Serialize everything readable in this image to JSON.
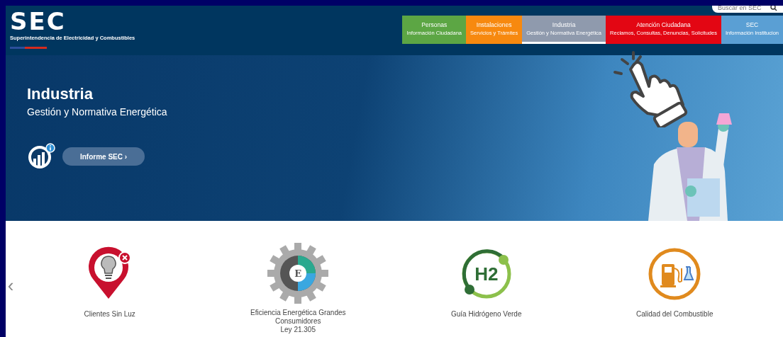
{
  "header": {
    "logo": "SEC",
    "logo_subtitle": "Superintendencia de Electricidad y Combustibles",
    "search": {
      "placeholder": "Buscar en SEC"
    }
  },
  "nav": [
    {
      "title": "Personas",
      "subtitle": "Información Ciudadana",
      "color": "#5ca644",
      "selected": false
    },
    {
      "title": "Instalaciones",
      "subtitle": "Servicios y Trámites",
      "color": "#f7890f",
      "selected": false
    },
    {
      "title": "Industria",
      "subtitle": "Gestión y Normativa Energética",
      "color": "#8f9aad",
      "selected": true
    },
    {
      "title": "Atención Ciudadana",
      "subtitle": "Reclamos, Consultas, Denuncias, Solicitudes",
      "color": "#e30613",
      "selected": false
    },
    {
      "title": "SEC",
      "subtitle": "Información Institucion",
      "color": "#5a9fd4",
      "selected": false
    }
  ],
  "hero": {
    "title": "Industria",
    "subtitle": "Gestión y Normativa Energética",
    "button": "Informe SEC ›"
  },
  "services": [
    {
      "kind": "pin-bulb",
      "lines": [
        "Clientes Sin Luz"
      ]
    },
    {
      "kind": "gear",
      "icon_text": "E",
      "lines": [
        "Eficiencia Energética Grandes",
        "Consumidores",
        "Ley 21.305"
      ]
    },
    {
      "kind": "h2",
      "icon_text": "H2",
      "lines": [
        "Guía Hidrógeno Verde"
      ]
    },
    {
      "kind": "fuel",
      "lines": [
        "Calidad del Combustible"
      ]
    }
  ],
  "carousel": {
    "prev": "‹"
  }
}
